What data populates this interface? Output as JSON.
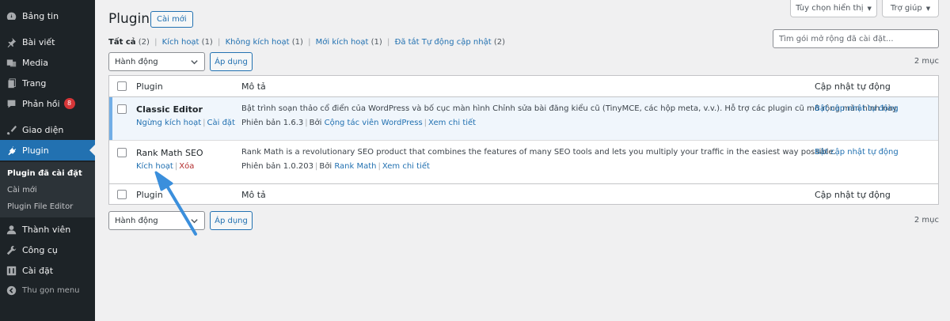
{
  "sidebar": {
    "items": [
      {
        "label": "Bảng tin",
        "icon": "dashboard-icon"
      },
      {
        "label": "Bài viết",
        "icon": "pin-icon"
      },
      {
        "label": "Media",
        "icon": "media-icon"
      },
      {
        "label": "Trang",
        "icon": "page-icon"
      },
      {
        "label": "Phản hồi",
        "icon": "comment-icon",
        "badge": "8"
      },
      {
        "label": "Giao diện",
        "icon": "brush-icon"
      },
      {
        "label": "Plugin",
        "icon": "plugin-icon"
      },
      {
        "label": "Thành viên",
        "icon": "user-icon"
      },
      {
        "label": "Công cụ",
        "icon": "wrench-icon"
      },
      {
        "label": "Cài đặt",
        "icon": "settings-icon"
      },
      {
        "label": "Thu gọn menu",
        "icon": "collapse-icon"
      }
    ],
    "submenu": [
      "Plugin đã cài đặt",
      "Cài mới",
      "Plugin File Editor"
    ]
  },
  "screen_options": "Tùy chọn hiển thị",
  "help": "Trợ giúp",
  "header": {
    "title": "Plugin",
    "add_new": "Cài mới"
  },
  "filters": [
    {
      "label": "Tất cả",
      "count": "(2)"
    },
    {
      "label": "Kích hoạt",
      "count": "(1)"
    },
    {
      "label": "Không kích hoạt",
      "count": "(1)"
    },
    {
      "label": "Mới kích hoạt",
      "count": "(1)"
    },
    {
      "label": "Đã tắt Tự động cập nhật",
      "count": "(2)"
    }
  ],
  "search": {
    "placeholder": "Tìm gói mở rộng đã cài đặt..."
  },
  "bulk": {
    "select": "Hành động",
    "apply": "Áp dụng",
    "count": "2 mục"
  },
  "table": {
    "columns": [
      "Plugin",
      "Mô tả",
      "Cập nhật tự động"
    ],
    "rows": [
      {
        "name": "Classic Editor",
        "actions": [
          "Ngừng kích hoạt",
          "Cài đặt"
        ],
        "description": "Bật trình soạn thảo cổ điển của WordPress và bố cục màn hình Chỉnh sửa bài đăng kiểu cũ (TinyMCE, các hộp meta, v.v.). Hỗ trợ các plugin cũ mở rộng màn hình này.",
        "version": "Phiên bản 1.6.3",
        "by": "Bởi",
        "author": "Cộng tác viên WordPress",
        "details": "Xem chi tiết",
        "auto_update": "Bật cập nhật tự động"
      },
      {
        "name": "Rank Math SEO",
        "actions": [
          "Kích hoạt",
          "Xóa"
        ],
        "description": "Rank Math is a revolutionary SEO product that combines the features of many SEO tools and lets you multiply your traffic in the easiest way possible.",
        "version": "Phiên bản 1.0.203",
        "by": "Bởi",
        "author": "Rank Math",
        "details": "Xem chi tiết",
        "auto_update": "Bật cập nhật tự động"
      }
    ]
  },
  "colors": {
    "accent": "#2271b1",
    "sidebar": "#1d2327",
    "arrow": "#3b8fdc"
  }
}
